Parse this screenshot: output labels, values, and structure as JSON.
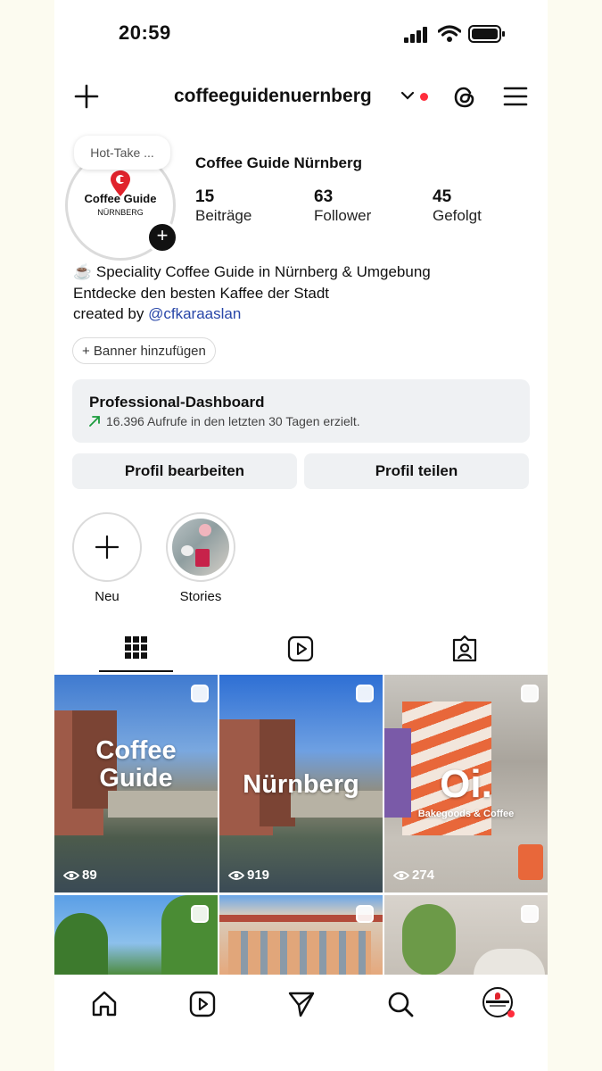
{
  "status_bar": {
    "time": "20:59"
  },
  "top_nav": {
    "username": "coffeeguidenuernberg"
  },
  "profile": {
    "note": "Hot-Take ...",
    "logo_line1": "Coffee Guide",
    "logo_line2": "NÜRNBERG",
    "display_name": "Coffee Guide Nürnberg",
    "stats": [
      {
        "value": "15",
        "label": "Beiträge"
      },
      {
        "value": "63",
        "label": "Follower"
      },
      {
        "value": "45",
        "label": "Gefolgt"
      }
    ],
    "bio_line1": "☕ Speciality Coffee Guide in Nürnberg & Umgebung",
    "bio_line2": "Entdecke den besten Kaffee der Stadt",
    "bio_created": "created by ",
    "bio_handle": "@cfkaraaslan"
  },
  "banner_button": "+ Banner hinzufügen",
  "dashboard": {
    "title": "Professional-Dashboard",
    "subtitle": "16.396 Aufrufe in den letzten 30 Tagen erzielt."
  },
  "actions": {
    "edit": "Profil bearbeiten",
    "share": "Profil teilen"
  },
  "highlights": [
    {
      "label": "Neu"
    },
    {
      "label": "Stories"
    }
  ],
  "posts": [
    {
      "title_line1": "Coffee",
      "title_line2": "Guide",
      "views": "89"
    },
    {
      "title_line1": "Nürnberg",
      "title_line2": "",
      "views": "919"
    },
    {
      "title_line1": "Oi.",
      "title_line2": "Bakegoods & Coffee",
      "views": "274"
    }
  ],
  "colors": {
    "accent_link": "#2846a8",
    "notification_dot": "#ff2d3c",
    "button_bg": "#eff1f3",
    "trend_arrow": "#1a9b3c"
  }
}
